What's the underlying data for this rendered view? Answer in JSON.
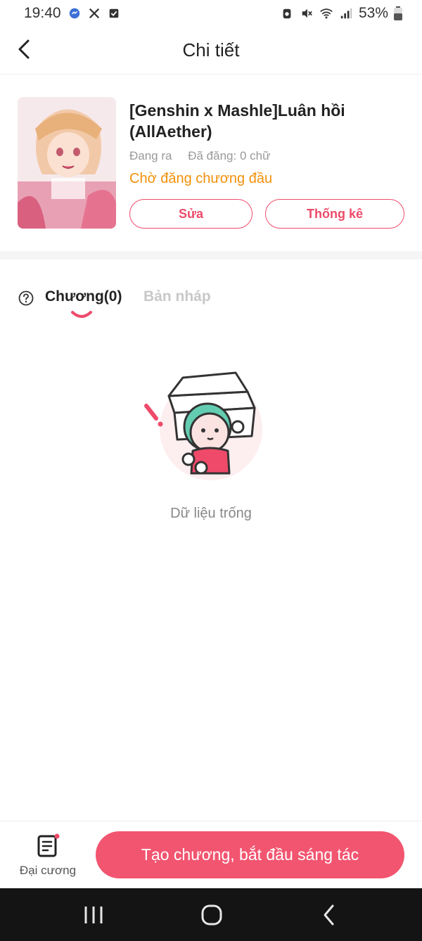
{
  "status_bar": {
    "time": "19:40",
    "battery": "53%",
    "icons_left": [
      "messenger-icon",
      "x-icon",
      "check-box-icon"
    ],
    "icons_right": [
      "recycle-icon",
      "mute-icon",
      "wifi-icon",
      "signal-icon",
      "battery-icon"
    ]
  },
  "header": {
    "title": "Chi tiết",
    "back_icon": "chevron-left-icon"
  },
  "book": {
    "title": "[Genshin x Mashle]Luân hồi (AllAether)",
    "status": "Đang ra",
    "published": "Đã đăng: 0 chữ",
    "pending_note": "Chờ đăng chương đầu",
    "edit_label": "Sửa",
    "stats_label": "Thống kê"
  },
  "tabs": {
    "chapters_label": "Chương(0)",
    "drafts_label": "Bản nháp",
    "active": "chapters"
  },
  "empty_state": {
    "text": "Dữ liệu trống"
  },
  "bottom": {
    "outline_label": "Đại cương",
    "create_label": "Tạo chương, bắt đầu sáng tác"
  },
  "colors": {
    "accent": "#ee4b6a",
    "create_button": "#f25570",
    "pending": "#f2900a",
    "muted": "#999999"
  }
}
